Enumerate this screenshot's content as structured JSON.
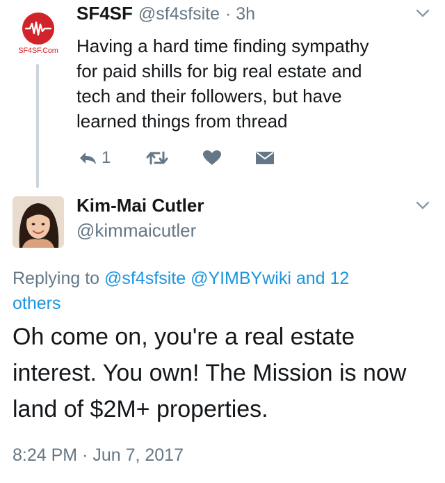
{
  "tweet1": {
    "avatar_logo_text": "SF4SF.Com",
    "display_name": "SF4SF",
    "handle": "@sf4sfsite",
    "time": "· 3h",
    "text_lines": [
      "Having a hard time finding sympathy",
      "for paid shills for big real estate and",
      "tech and their followers, but have",
      "learned things from thread"
    ],
    "reply_count": "1",
    "icons": [
      "reply-icon",
      "retweet-icon",
      "heart-icon",
      "dm-envelope-icon",
      "chevron-down-icon"
    ]
  },
  "tweet2": {
    "display_name": "Kim-Mai Cutler",
    "handle": "@kimmaicutler",
    "replying_prefix": "Replying to",
    "reply_mentions": [
      "@sf4sfsite",
      "@YIMBYwiki",
      "and 12",
      "others"
    ],
    "text_lines": [
      "Oh come on, you're a real estate",
      "interest. You own! The Mission is now",
      "land of $2M+ properties."
    ],
    "timestamp": "8:24 PM · Jun 7, 2017"
  },
  "colors": {
    "text": "#14171a",
    "secondary": "#657786",
    "link": "#1b95e0",
    "brand_red": "#d0232a",
    "thread_line": "#cdd5dc"
  }
}
